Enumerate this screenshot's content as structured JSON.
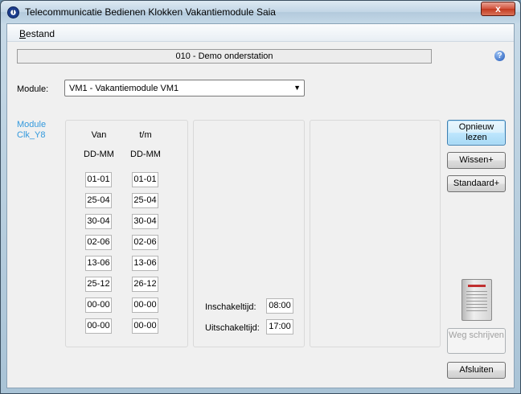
{
  "window": {
    "title": "Telecommunicatie Bedienen Klokken Vakantiemodule Saia",
    "close_label": "x"
  },
  "menu": {
    "items": [
      "Bestand"
    ]
  },
  "station": {
    "name": "010 - Demo onderstation"
  },
  "module": {
    "label": "Module:",
    "selected": "VM1 - Vakantiemodule VM1",
    "link_line1": "Module",
    "link_line2": "Clk_Y8"
  },
  "dates": {
    "col_from": "Van",
    "col_to": "t/m",
    "format_from": "DD-MM",
    "format_to": "DD-MM",
    "rows": [
      {
        "from": "01-01",
        "to": "01-01"
      },
      {
        "from": "25-04",
        "to": "25-04"
      },
      {
        "from": "30-04",
        "to": "30-04"
      },
      {
        "from": "02-06",
        "to": "02-06"
      },
      {
        "from": "13-06",
        "to": "13-06"
      },
      {
        "from": "25-12",
        "to": "26-12"
      },
      {
        "from": "00-00",
        "to": "00-00"
      },
      {
        "from": "00-00",
        "to": "00-00"
      }
    ]
  },
  "times": {
    "on_label": "Inschakeltijd:",
    "on_value": "08:00",
    "off_label": "Uitschakeltijd:",
    "off_value": "17:00"
  },
  "buttons": {
    "reload": "Opnieuw lezen",
    "clear": "Wissen+",
    "default": "Standaard+",
    "write": "Weg schrijven",
    "close": "Afsluiten"
  },
  "colors": {
    "link": "#3399dd",
    "close_button": "#c23a20"
  }
}
